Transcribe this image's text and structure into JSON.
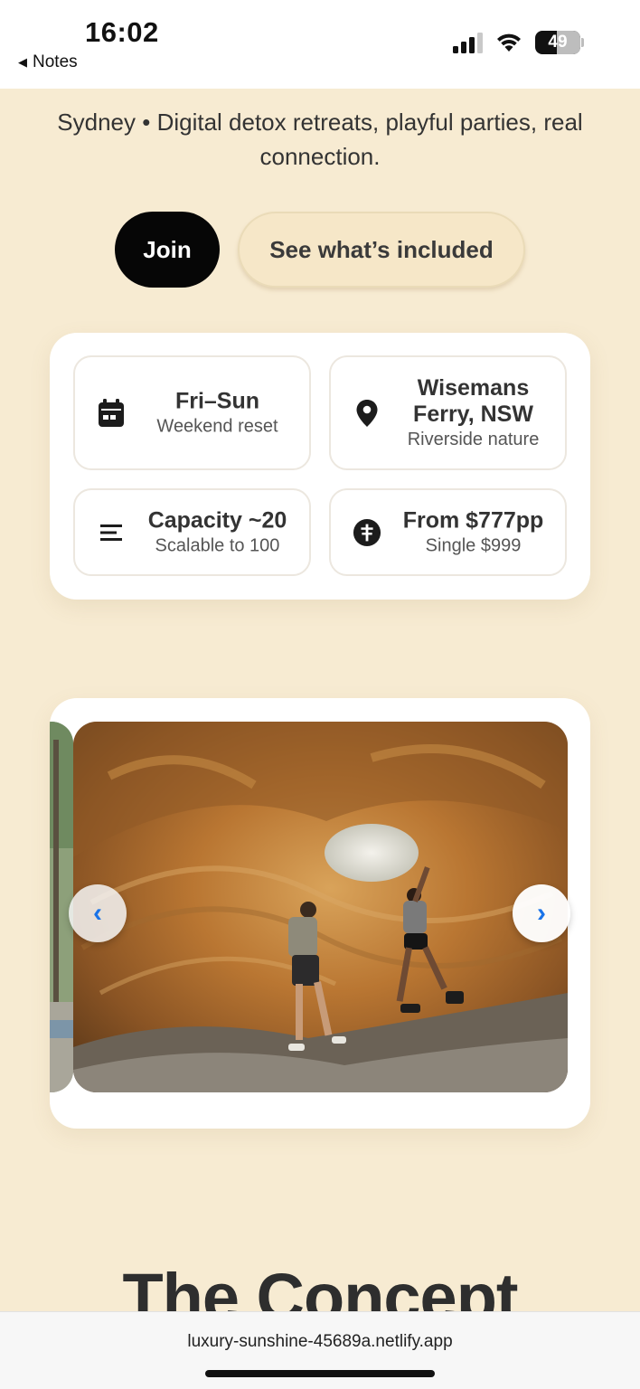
{
  "status_bar": {
    "time": "16:02",
    "back_label": "Notes",
    "battery": "49"
  },
  "hero": {
    "tagline": "Sydney • Digital detox retreats, playful parties, real connection.",
    "join_label": "Join",
    "included_label": "See what’s included"
  },
  "info": [
    {
      "icon": "calendar-icon",
      "title": "Fri–Sun",
      "subtitle": "Weekend reset"
    },
    {
      "icon": "location-pin-icon",
      "title": "Wisemans Ferry, NSW",
      "subtitle": "Riverside nature"
    },
    {
      "icon": "capacity-lines-icon",
      "title": "Capacity ~20",
      "subtitle": "Scalable to 100"
    },
    {
      "icon": "price-tag-icon",
      "title": "From $777pp",
      "subtitle": "Single $999"
    }
  ],
  "gallery": {
    "prev_glyph": "‹",
    "next_glyph": "›"
  },
  "section": {
    "heading": "The Concept"
  },
  "browser": {
    "url": "luxury-sunshine-45689a.netlify.app"
  },
  "colors": {
    "background": "#f7ebd2",
    "primary_button": "#060606",
    "arrow": "#1a73e8"
  }
}
